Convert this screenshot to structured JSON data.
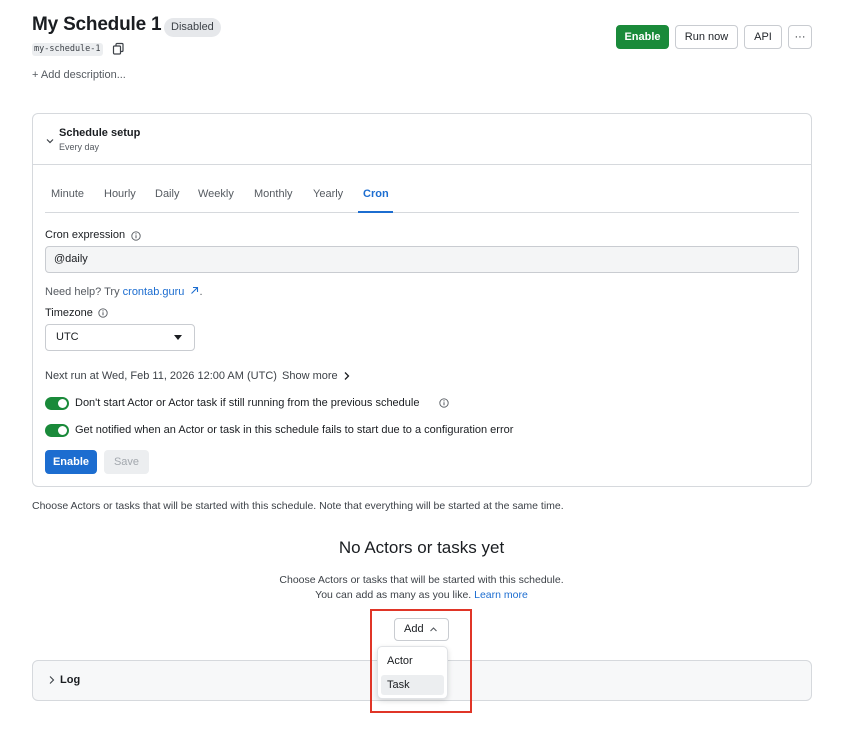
{
  "header": {
    "title": "My Schedule 1",
    "status_badge": "Disabled",
    "slug": "my-schedule-1",
    "add_description": "+ Add description...",
    "buttons": {
      "enable": "Enable",
      "run_now": "Run now",
      "api": "API",
      "more": "···"
    }
  },
  "schedule_setup": {
    "title": "Schedule setup",
    "subtitle": "Every day",
    "tabs": [
      "Minute",
      "Hourly",
      "Daily",
      "Weekly",
      "Monthly",
      "Yearly",
      "Cron"
    ],
    "active_tab": "Cron",
    "cron_label": "Cron expression",
    "cron_value": "@daily",
    "help_prefix": "Need help? Try ",
    "help_link": "crontab.guru",
    "help_suffix": ".",
    "timezone_label": "Timezone",
    "timezone_value": "UTC",
    "next_run": "Next run at Wed, Feb 11, 2026 12:00 AM (UTC)",
    "show_more": "Show more",
    "toggles": [
      {
        "label": "Don't start Actor or Actor task if still running from the previous schedule",
        "on": true
      },
      {
        "label": "Get notified when an Actor or task in this schedule fails to start due to a configuration error",
        "on": true
      }
    ],
    "enable_button": "Enable",
    "save_button": "Save"
  },
  "actors_section": {
    "intro": "Choose Actors or tasks that will be started with this schedule. Note that everything will be started at the same time.",
    "empty_title": "No Actors or tasks yet",
    "empty_line1": "Choose Actors or tasks that will be started with this schedule.",
    "empty_line2_prefix": "You can add as many as you like. ",
    "learn_more": "Learn more",
    "add_button": "Add",
    "menu_items": [
      "Actor",
      "Task"
    ]
  },
  "log": {
    "title": "Log"
  },
  "colors": {
    "primary_green": "#1a8a3a",
    "primary_blue": "#1c6dd0",
    "highlight_red": "#e03527"
  },
  "icons": [
    "copy-icon",
    "chevron-down-icon",
    "info-icon",
    "external-link-icon",
    "caret-down-icon",
    "chevron-right-icon",
    "chevron-up-icon"
  ]
}
